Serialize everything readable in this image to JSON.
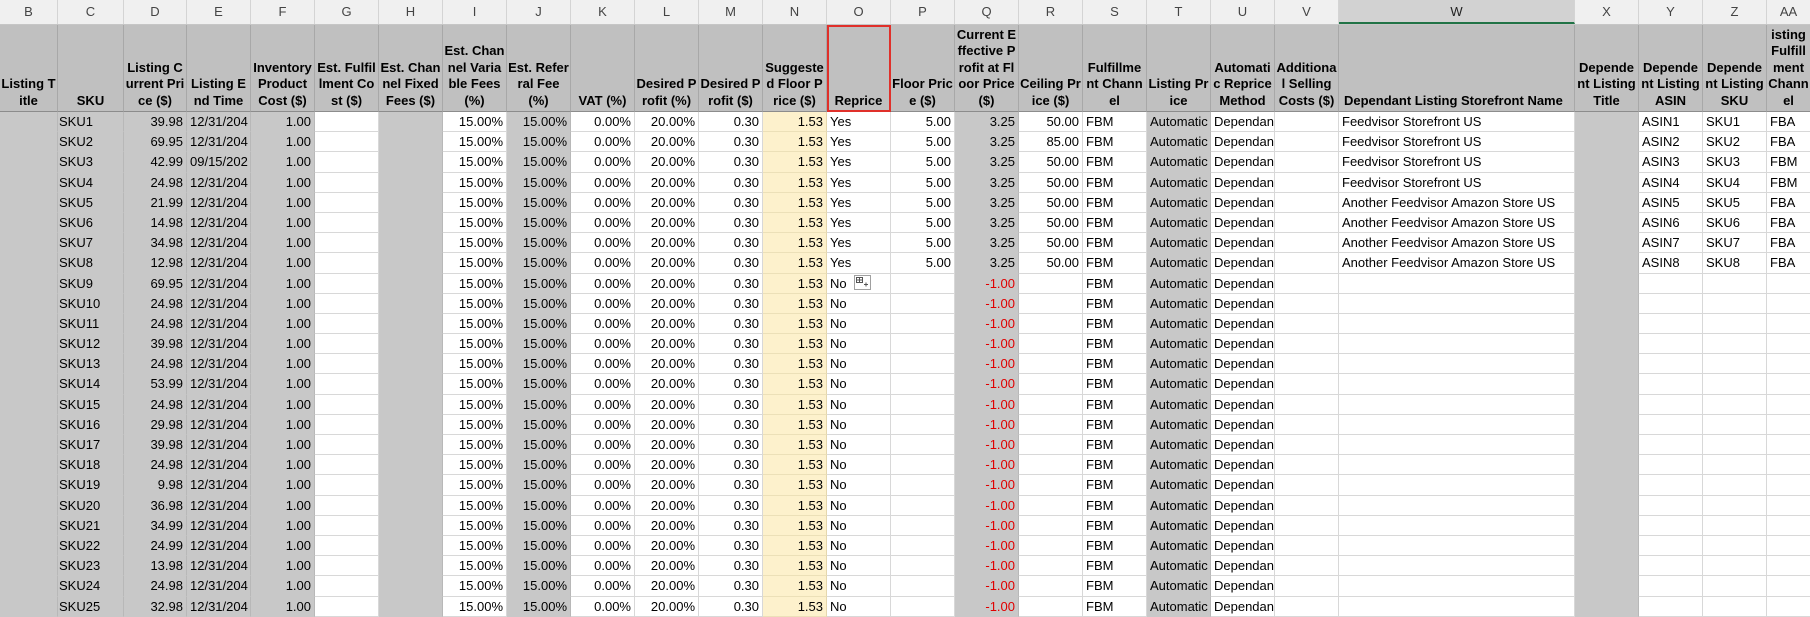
{
  "columns": [
    {
      "letter": "B",
      "width": 58,
      "header": "Listing Title",
      "shade": "gray",
      "align": "left"
    },
    {
      "letter": "C",
      "width": 66,
      "header": "SKU",
      "shade": "gray",
      "align": "sku"
    },
    {
      "letter": "D",
      "width": 63,
      "header": "Listing Current Price ($)",
      "shade": "gray",
      "align": "num"
    },
    {
      "letter": "E",
      "width": 64,
      "header": "Listing End Time",
      "shade": "gray",
      "align": "clip"
    },
    {
      "letter": "F",
      "width": 64,
      "header": "Inventory Product Cost ($)",
      "shade": "gray",
      "align": "num"
    },
    {
      "letter": "G",
      "width": 64,
      "header": "Est. Fulfillment Cost ($)",
      "shade": "white",
      "align": "num"
    },
    {
      "letter": "H",
      "width": 64,
      "header": "Est. Channel Fixed Fees ($)",
      "shade": "gray",
      "align": "num"
    },
    {
      "letter": "I",
      "width": 64,
      "header": "Est. Channel Variable Fees (%)",
      "shade": "white",
      "align": "num"
    },
    {
      "letter": "J",
      "width": 64,
      "header": "Est. Referral Fee (%)",
      "shade": "gray",
      "align": "num"
    },
    {
      "letter": "K",
      "width": 64,
      "header": "VAT (%)",
      "shade": "white",
      "align": "num"
    },
    {
      "letter": "L",
      "width": 64,
      "header": "Desired Profit (%)",
      "shade": "white",
      "align": "num"
    },
    {
      "letter": "M",
      "width": 64,
      "header": "Desired Profit ($)",
      "shade": "white",
      "align": "num"
    },
    {
      "letter": "N",
      "width": 64,
      "header": "Suggested Floor Price ($)",
      "shade": "yellow",
      "align": "num"
    },
    {
      "letter": "O",
      "width": 64,
      "header": "Reprice",
      "shade": "white",
      "align": "left",
      "highlight": true
    },
    {
      "letter": "P",
      "width": 64,
      "header": "Floor Price ($)",
      "shade": "white",
      "align": "num"
    },
    {
      "letter": "Q",
      "width": 64,
      "header": "Current Effective Profit at Floor Price ($)",
      "shade": "gray",
      "align": "num"
    },
    {
      "letter": "R",
      "width": 64,
      "header": "Ceiling Price ($)",
      "shade": "white",
      "align": "num"
    },
    {
      "letter": "S",
      "width": 64,
      "header": "Fulfillment Channel",
      "shade": "white",
      "align": "left"
    },
    {
      "letter": "T",
      "width": 64,
      "header": "Listing Price",
      "shade": "gray",
      "align": "clip"
    },
    {
      "letter": "U",
      "width": 64,
      "header": "Automatic Reprice Method",
      "shade": "white",
      "align": "left"
    },
    {
      "letter": "V",
      "width": 64,
      "header": "Additional Selling Costs ($)",
      "shade": "white",
      "align": "num"
    },
    {
      "letter": "W",
      "width": 236,
      "header": "Dependant Listing Storefront Name",
      "shade": "white",
      "align": "left",
      "hdr_left": true
    },
    {
      "letter": "X",
      "width": 64,
      "header": "Dependent Listing Title",
      "shade": "gray",
      "align": "left"
    },
    {
      "letter": "Y",
      "width": 64,
      "header": "Dependent Listing ASIN",
      "shade": "white",
      "align": "left"
    },
    {
      "letter": "Z",
      "width": 64,
      "header": "Dependent Listing SKU",
      "shade": "white",
      "align": "left"
    },
    {
      "letter": "AA",
      "width": 44,
      "header": "Dependent Listing Fulfillment Channel",
      "shade": "white",
      "align": "left"
    }
  ],
  "selected_column": "W",
  "rows": [
    [
      "",
      "SKU1",
      "39.98",
      "12/31/204",
      "1.00",
      "",
      "",
      "15.00%",
      "15.00%",
      "0.00%",
      "20.00%",
      "0.30",
      "1.53",
      "Yes",
      "5.00",
      "3.25",
      "50.00",
      "FBM",
      "Automatic",
      "Dependant",
      "",
      "Feedvisor Storefront US",
      "",
      "ASIN1",
      "SKU1",
      "FBA"
    ],
    [
      "",
      "SKU2",
      "69.95",
      "12/31/204",
      "1.00",
      "",
      "",
      "15.00%",
      "15.00%",
      "0.00%",
      "20.00%",
      "0.30",
      "1.53",
      "Yes",
      "5.00",
      "3.25",
      "85.00",
      "FBM",
      "Automatic",
      "Dependant",
      "",
      "Feedvisor Storefront US",
      "",
      "ASIN2",
      "SKU2",
      "FBA"
    ],
    [
      "",
      "SKU3",
      "42.99",
      "09/15/202",
      "1.00",
      "",
      "",
      "15.00%",
      "15.00%",
      "0.00%",
      "20.00%",
      "0.30",
      "1.53",
      "Yes",
      "5.00",
      "3.25",
      "50.00",
      "FBM",
      "Automatic",
      "Dependant",
      "",
      "Feedvisor Storefront US",
      "",
      "ASIN3",
      "SKU3",
      "FBM"
    ],
    [
      "",
      "SKU4",
      "24.98",
      "12/31/204",
      "1.00",
      "",
      "",
      "15.00%",
      "15.00%",
      "0.00%",
      "20.00%",
      "0.30",
      "1.53",
      "Yes",
      "5.00",
      "3.25",
      "50.00",
      "FBM",
      "Automatic",
      "Dependant",
      "",
      "Feedvisor Storefront US",
      "",
      "ASIN4",
      "SKU4",
      "FBM"
    ],
    [
      "",
      "SKU5",
      "21.99",
      "12/31/204",
      "1.00",
      "",
      "",
      "15.00%",
      "15.00%",
      "0.00%",
      "20.00%",
      "0.30",
      "1.53",
      "Yes",
      "5.00",
      "3.25",
      "50.00",
      "FBM",
      "Automatic",
      "Dependant",
      "",
      "Another Feedvisor Amazon Store US",
      "",
      "ASIN5",
      "SKU5",
      "FBA"
    ],
    [
      "",
      "SKU6",
      "14.98",
      "12/31/204",
      "1.00",
      "",
      "",
      "15.00%",
      "15.00%",
      "0.00%",
      "20.00%",
      "0.30",
      "1.53",
      "Yes",
      "5.00",
      "3.25",
      "50.00",
      "FBM",
      "Automatic",
      "Dependant",
      "",
      "Another Feedvisor Amazon Store US",
      "",
      "ASIN6",
      "SKU6",
      "FBA"
    ],
    [
      "",
      "SKU7",
      "34.98",
      "12/31/204",
      "1.00",
      "",
      "",
      "15.00%",
      "15.00%",
      "0.00%",
      "20.00%",
      "0.30",
      "1.53",
      "Yes",
      "5.00",
      "3.25",
      "50.00",
      "FBM",
      "Automatic",
      "Dependant",
      "",
      "Another Feedvisor Amazon Store US",
      "",
      "ASIN7",
      "SKU7",
      "FBA"
    ],
    [
      "",
      "SKU8",
      "12.98",
      "12/31/204",
      "1.00",
      "",
      "",
      "15.00%",
      "15.00%",
      "0.00%",
      "20.00%",
      "0.30",
      "1.53",
      "Yes",
      "5.00",
      "3.25",
      "50.00",
      "FBM",
      "Automatic",
      "Dependant",
      "",
      "Another Feedvisor Amazon Store US",
      "",
      "ASIN8",
      "SKU8",
      "FBA"
    ],
    [
      "",
      "SKU9",
      "69.95",
      "12/31/204",
      "1.00",
      "",
      "",
      "15.00%",
      "15.00%",
      "0.00%",
      "20.00%",
      "0.30",
      "1.53",
      "No",
      "",
      "-1.00",
      "",
      "FBM",
      "Automatic",
      "Dependant",
      "",
      "",
      "",
      "",
      "",
      ""
    ],
    [
      "",
      "SKU10",
      "24.98",
      "12/31/204",
      "1.00",
      "",
      "",
      "15.00%",
      "15.00%",
      "0.00%",
      "20.00%",
      "0.30",
      "1.53",
      "No",
      "",
      "-1.00",
      "",
      "FBM",
      "Automatic",
      "Dependant",
      "",
      "",
      "",
      "",
      "",
      ""
    ],
    [
      "",
      "SKU11",
      "24.98",
      "12/31/204",
      "1.00",
      "",
      "",
      "15.00%",
      "15.00%",
      "0.00%",
      "20.00%",
      "0.30",
      "1.53",
      "No",
      "",
      "-1.00",
      "",
      "FBM",
      "Automatic",
      "Dependant",
      "",
      "",
      "",
      "",
      "",
      ""
    ],
    [
      "",
      "SKU12",
      "39.98",
      "12/31/204",
      "1.00",
      "",
      "",
      "15.00%",
      "15.00%",
      "0.00%",
      "20.00%",
      "0.30",
      "1.53",
      "No",
      "",
      "-1.00",
      "",
      "FBM",
      "Automatic",
      "Dependant",
      "",
      "",
      "",
      "",
      "",
      ""
    ],
    [
      "",
      "SKU13",
      "24.98",
      "12/31/204",
      "1.00",
      "",
      "",
      "15.00%",
      "15.00%",
      "0.00%",
      "20.00%",
      "0.30",
      "1.53",
      "No",
      "",
      "-1.00",
      "",
      "FBM",
      "Automatic",
      "Dependant",
      "",
      "",
      "",
      "",
      "",
      ""
    ],
    [
      "",
      "SKU14",
      "53.99",
      "12/31/204",
      "1.00",
      "",
      "",
      "15.00%",
      "15.00%",
      "0.00%",
      "20.00%",
      "0.30",
      "1.53",
      "No",
      "",
      "-1.00",
      "",
      "FBM",
      "Automatic",
      "Dependant",
      "",
      "",
      "",
      "",
      "",
      ""
    ],
    [
      "",
      "SKU15",
      "24.98",
      "12/31/204",
      "1.00",
      "",
      "",
      "15.00%",
      "15.00%",
      "0.00%",
      "20.00%",
      "0.30",
      "1.53",
      "No",
      "",
      "-1.00",
      "",
      "FBM",
      "Automatic",
      "Dependant",
      "",
      "",
      "",
      "",
      "",
      ""
    ],
    [
      "",
      "SKU16",
      "29.98",
      "12/31/204",
      "1.00",
      "",
      "",
      "15.00%",
      "15.00%",
      "0.00%",
      "20.00%",
      "0.30",
      "1.53",
      "No",
      "",
      "-1.00",
      "",
      "FBM",
      "Automatic",
      "Dependant",
      "",
      "",
      "",
      "",
      "",
      ""
    ],
    [
      "",
      "SKU17",
      "39.98",
      "12/31/204",
      "1.00",
      "",
      "",
      "15.00%",
      "15.00%",
      "0.00%",
      "20.00%",
      "0.30",
      "1.53",
      "No",
      "",
      "-1.00",
      "",
      "FBM",
      "Automatic",
      "Dependant",
      "",
      "",
      "",
      "",
      "",
      ""
    ],
    [
      "",
      "SKU18",
      "24.98",
      "12/31/204",
      "1.00",
      "",
      "",
      "15.00%",
      "15.00%",
      "0.00%",
      "20.00%",
      "0.30",
      "1.53",
      "No",
      "",
      "-1.00",
      "",
      "FBM",
      "Automatic",
      "Dependant",
      "",
      "",
      "",
      "",
      "",
      ""
    ],
    [
      "",
      "SKU19",
      "9.98",
      "12/31/204",
      "1.00",
      "",
      "",
      "15.00%",
      "15.00%",
      "0.00%",
      "20.00%",
      "0.30",
      "1.53",
      "No",
      "",
      "-1.00",
      "",
      "FBM",
      "Automatic",
      "Dependant",
      "",
      "",
      "",
      "",
      "",
      ""
    ],
    [
      "",
      "SKU20",
      "36.98",
      "12/31/204",
      "1.00",
      "",
      "",
      "15.00%",
      "15.00%",
      "0.00%",
      "20.00%",
      "0.30",
      "1.53",
      "No",
      "",
      "-1.00",
      "",
      "FBM",
      "Automatic",
      "Dependant",
      "",
      "",
      "",
      "",
      "",
      ""
    ],
    [
      "",
      "SKU21",
      "34.99",
      "12/31/204",
      "1.00",
      "",
      "",
      "15.00%",
      "15.00%",
      "0.00%",
      "20.00%",
      "0.30",
      "1.53",
      "No",
      "",
      "-1.00",
      "",
      "FBM",
      "Automatic",
      "Dependant",
      "",
      "",
      "",
      "",
      "",
      ""
    ],
    [
      "",
      "SKU22",
      "24.99",
      "12/31/204",
      "1.00",
      "",
      "",
      "15.00%",
      "15.00%",
      "0.00%",
      "20.00%",
      "0.30",
      "1.53",
      "No",
      "",
      "-1.00",
      "",
      "FBM",
      "Automatic",
      "Dependant",
      "",
      "",
      "",
      "",
      "",
      ""
    ],
    [
      "",
      "SKU23",
      "13.98",
      "12/31/204",
      "1.00",
      "",
      "",
      "15.00%",
      "15.00%",
      "0.00%",
      "20.00%",
      "0.30",
      "1.53",
      "No",
      "",
      "-1.00",
      "",
      "FBM",
      "Automatic",
      "Dependant",
      "",
      "",
      "",
      "",
      "",
      ""
    ],
    [
      "",
      "SKU24",
      "24.98",
      "12/31/204",
      "1.00",
      "",
      "",
      "15.00%",
      "15.00%",
      "0.00%",
      "20.00%",
      "0.30",
      "1.53",
      "No",
      "",
      "-1.00",
      "",
      "FBM",
      "Automatic",
      "Dependant",
      "",
      "",
      "",
      "",
      "",
      ""
    ],
    [
      "",
      "SKU25",
      "32.98",
      "12/31/204",
      "1.00",
      "",
      "",
      "15.00%",
      "15.00%",
      "0.00%",
      "20.00%",
      "0.30",
      "1.53",
      "No",
      "",
      "-1.00",
      "",
      "FBM",
      "Automatic",
      "Dependant",
      "",
      "",
      "",
      "",
      "",
      ""
    ]
  ],
  "quick_analysis": {
    "row": 8,
    "col": 13,
    "icon": "quick-analysis-icon"
  },
  "colors": {
    "header_gray": "#c0c0c0",
    "yellow": "#fdf1cc",
    "negative": "#e00000",
    "highlight": "#e0302a",
    "selected_col": "#217346"
  }
}
